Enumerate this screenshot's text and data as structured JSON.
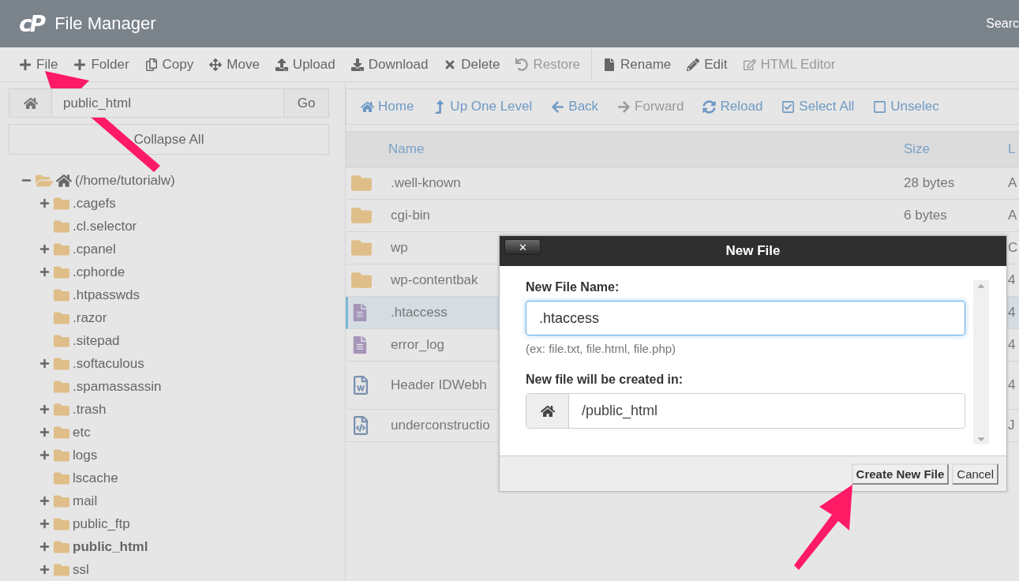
{
  "header": {
    "logo": "cP",
    "title": "File Manager",
    "search_label": "Searc"
  },
  "toolbar": [
    {
      "label": "File",
      "disabled": false
    },
    {
      "label": "Folder",
      "disabled": false
    },
    {
      "label": "Copy",
      "disabled": false
    },
    {
      "label": "Move",
      "disabled": false
    },
    {
      "label": "Upload",
      "disabled": false
    },
    {
      "label": "Download",
      "disabled": false
    },
    {
      "label": "Delete",
      "disabled": false
    },
    {
      "label": "Restore",
      "disabled": true
    },
    {
      "label": "Rename",
      "disabled": false
    },
    {
      "label": "Edit",
      "disabled": false
    },
    {
      "label": "HTML Editor",
      "disabled": true
    }
  ],
  "path_bar": {
    "value": "public_html",
    "go": "Go"
  },
  "collapse_all": "Collapse All",
  "tree": [
    {
      "label": "(/home/tutorialw)",
      "expandable": true,
      "expanded": true,
      "selected": false,
      "children": [
        {
          "label": ".cagefs",
          "expandable": true,
          "expanded": false,
          "selected": false
        },
        {
          "label": ".cl.selector",
          "expandable": false,
          "expanded": false,
          "selected": false
        },
        {
          "label": ".cpanel",
          "expandable": true,
          "expanded": false,
          "selected": false
        },
        {
          "label": ".cphorde",
          "expandable": true,
          "expanded": false,
          "selected": false
        },
        {
          "label": ".htpasswds",
          "expandable": false,
          "expanded": false,
          "selected": false
        },
        {
          "label": ".razor",
          "expandable": false,
          "expanded": false,
          "selected": false
        },
        {
          "label": ".sitepad",
          "expandable": false,
          "expanded": false,
          "selected": false
        },
        {
          "label": ".softaculous",
          "expandable": true,
          "expanded": false,
          "selected": false
        },
        {
          "label": ".spamassassin",
          "expandable": false,
          "expanded": false,
          "selected": false
        },
        {
          "label": ".trash",
          "expandable": true,
          "expanded": false,
          "selected": false
        },
        {
          "label": "etc",
          "expandable": true,
          "expanded": false,
          "selected": false
        },
        {
          "label": "logs",
          "expandable": true,
          "expanded": false,
          "selected": false
        },
        {
          "label": "lscache",
          "expandable": false,
          "expanded": false,
          "selected": false
        },
        {
          "label": "mail",
          "expandable": true,
          "expanded": false,
          "selected": false
        },
        {
          "label": "public_ftp",
          "expandable": true,
          "expanded": false,
          "selected": false
        },
        {
          "label": "public_html",
          "expandable": true,
          "expanded": false,
          "selected": true
        },
        {
          "label": "ssl",
          "expandable": true,
          "expanded": false,
          "selected": false
        }
      ]
    }
  ],
  "nav": [
    {
      "label": "Home",
      "disabled": false
    },
    {
      "label": "Up One Level",
      "disabled": false
    },
    {
      "label": "Back",
      "disabled": false
    },
    {
      "label": "Forward",
      "disabled": true
    },
    {
      "label": "Reload",
      "disabled": false
    },
    {
      "label": "Select All",
      "disabled": false
    },
    {
      "label": "Unselec",
      "disabled": false
    }
  ],
  "table": {
    "columns": [
      "Name",
      "Size",
      "L"
    ],
    "rows": [
      {
        "kind": "folder",
        "name": ".well-known",
        "size": "28 bytes",
        "column_3": "A",
        "selected": false
      },
      {
        "kind": "folder",
        "name": "cgi-bin",
        "size": "6 bytes",
        "column_3": "A",
        "selected": false
      },
      {
        "kind": "folder",
        "name": "wp",
        "column_3": "C",
        "selected": false
      },
      {
        "kind": "folder",
        "name": "wp-contentbak",
        "column_3": "4",
        "selected": false
      },
      {
        "kind": "text",
        "name": ".htaccess",
        "column_3": "4",
        "selected": true
      },
      {
        "kind": "text",
        "name": "error_log",
        "column_3": "4",
        "selected": false
      },
      {
        "kind": "word",
        "name": "Header IDWebh",
        "column_3": "4",
        "selected": false
      },
      {
        "kind": "code",
        "name": "underconstructio",
        "column_3": "J",
        "selected": false
      }
    ]
  },
  "dialog": {
    "title": "New File",
    "close": "✕",
    "name_label": "New File Name:",
    "name_value": ".htaccess",
    "hint": "(ex: file.txt, file.html, file.php)",
    "location_label": "New file will be created in:",
    "location_value": "/public_html",
    "buttons": [
      "Create New File",
      "Cancel"
    ]
  }
}
